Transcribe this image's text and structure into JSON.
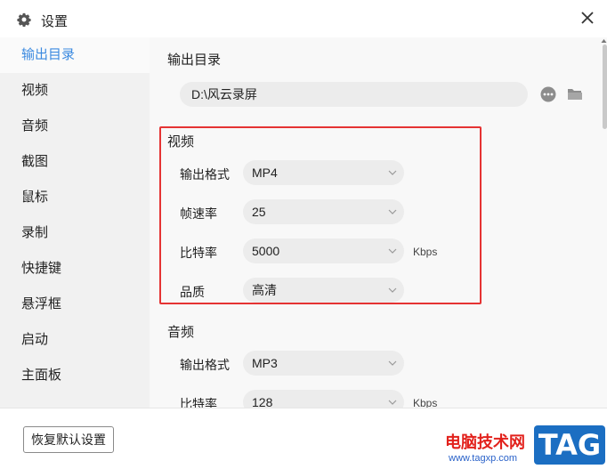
{
  "window": {
    "title": "设置"
  },
  "sidebar": {
    "items": [
      {
        "label": "输出目录"
      },
      {
        "label": "视频"
      },
      {
        "label": "音频"
      },
      {
        "label": "截图"
      },
      {
        "label": "鼠标"
      },
      {
        "label": "录制"
      },
      {
        "label": "快捷键"
      },
      {
        "label": "悬浮框"
      },
      {
        "label": "启动"
      },
      {
        "label": "主面板"
      }
    ]
  },
  "output": {
    "title": "输出目录",
    "path": "D:\\风云录屏",
    "more_icon": "ellipsis-circle",
    "folder_icon": "folder"
  },
  "video": {
    "title": "视频",
    "format_label": "输出格式",
    "format_value": "MP4",
    "fps_label": "帧速率",
    "fps_value": "25",
    "bitrate_label": "比特率",
    "bitrate_value": "5000",
    "bitrate_unit": "Kbps",
    "quality_label": "品质",
    "quality_value": "高清"
  },
  "audio": {
    "title": "音频",
    "format_label": "输出格式",
    "format_value": "MP3",
    "bitrate_label": "比特率",
    "bitrate_value": "128",
    "bitrate_unit": "Kbps"
  },
  "footer": {
    "reset_label": "恢复默认设置"
  },
  "watermark": {
    "cn": "电脑技术网",
    "url": "www.tagxp.com",
    "tag": "TAG"
  },
  "colors": {
    "accent": "#3b8ae0",
    "highlight": "#e53333"
  }
}
